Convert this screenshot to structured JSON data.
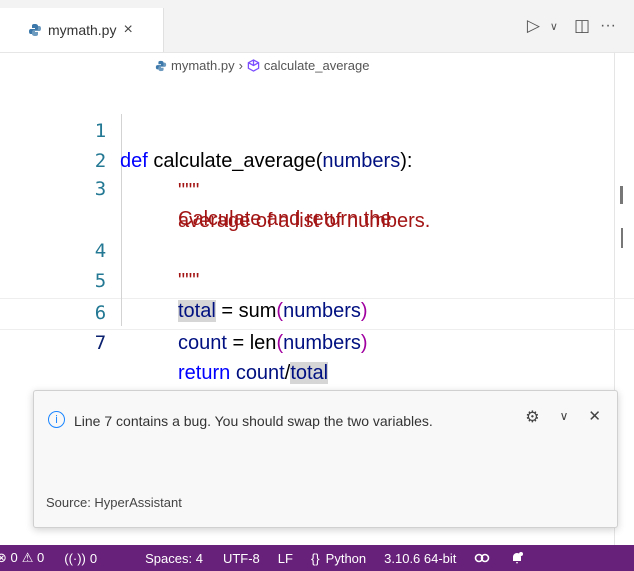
{
  "tab": {
    "filename": "mymath.py",
    "close": "×"
  },
  "actions": {
    "run": "▷",
    "run_dropdown": "∨",
    "split": "◫",
    "more": "···"
  },
  "breadcrumb": {
    "file": "mymath.py",
    "sep": "›",
    "symbol": "calculate_average"
  },
  "code": {
    "line_numbers": [
      "1",
      "2",
      "3",
      "4",
      "5",
      "6",
      "7"
    ],
    "l1": {
      "kw": "def",
      "name": "calculate_average",
      "open": "(",
      "param": "numbers",
      "close": "):"
    },
    "l2": "\"\"\"",
    "l3a": "Calculate and return the",
    "l3b": "average of a list of numbers.",
    "l4": "\"\"\"",
    "l5": {
      "var": "total",
      "eq": " = ",
      "fn": "sum",
      "open": "(",
      "arg": "numbers",
      "close": ")"
    },
    "l6": {
      "var": "count",
      "eq": " = ",
      "fn": "len",
      "open": "(",
      "arg": "numbers",
      "close": ")"
    },
    "l7": {
      "kw": "return",
      "sp": " ",
      "a": "count",
      "slash": "/",
      "b": "total"
    }
  },
  "notification": {
    "message": "Line 7 contains a bug. You should swap the two variables.",
    "source": "Source: HyperAssistant",
    "info_icon": "i",
    "gear": "⚙",
    "chevron": "∨",
    "close": "✕"
  },
  "statusbar": {
    "errors": "⊗ 0",
    "warnings": "⚠ 0",
    "ports": "0",
    "spaces": "Spaces: 4",
    "encoding": "UTF-8",
    "eol": "LF",
    "language_prefix": "{}",
    "language": "Python",
    "interpreter": "3.10.6 64-bit"
  }
}
